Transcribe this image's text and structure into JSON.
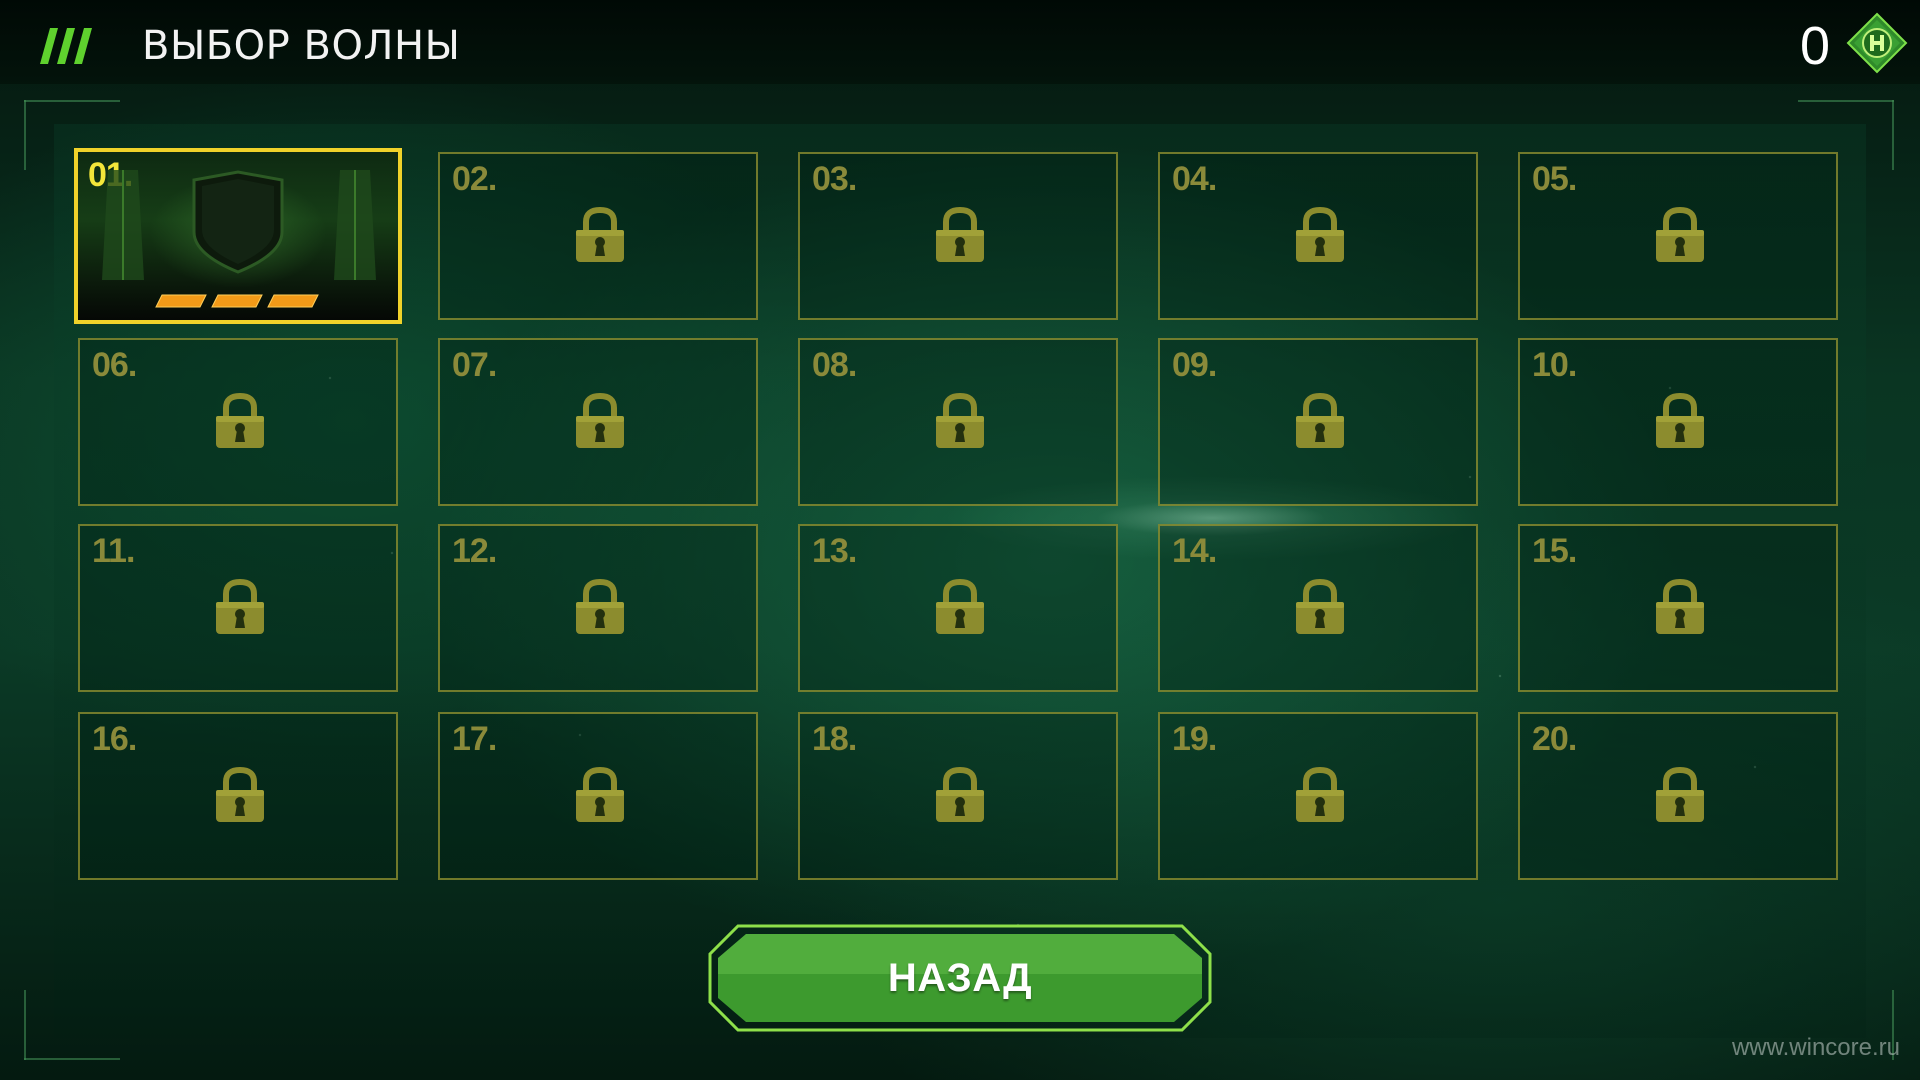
{
  "header": {
    "title": "ВЫБОР ВОЛНЫ",
    "currency_value": "0",
    "menu_icon": "menu-stripes-icon",
    "currency_icon": "hq-emblem-icon"
  },
  "waves": [
    {
      "label": "01.",
      "locked": false,
      "stars": 3
    },
    {
      "label": "02.",
      "locked": true
    },
    {
      "label": "03.",
      "locked": true
    },
    {
      "label": "04.",
      "locked": true
    },
    {
      "label": "05.",
      "locked": true
    },
    {
      "label": "06.",
      "locked": true
    },
    {
      "label": "07.",
      "locked": true
    },
    {
      "label": "08.",
      "locked": true
    },
    {
      "label": "09.",
      "locked": true
    },
    {
      "label": "10.",
      "locked": true
    },
    {
      "label": "11.",
      "locked": true
    },
    {
      "label": "12.",
      "locked": true
    },
    {
      "label": "13.",
      "locked": true
    },
    {
      "label": "14.",
      "locked": true
    },
    {
      "label": "15.",
      "locked": true
    },
    {
      "label": "16.",
      "locked": true
    },
    {
      "label": "17.",
      "locked": true
    },
    {
      "label": "18.",
      "locked": true
    },
    {
      "label": "19.",
      "locked": true
    },
    {
      "label": "20.",
      "locked": true
    }
  ],
  "footer": {
    "back_label": "НАЗАД"
  },
  "watermark": "www.wincore.ru",
  "colors": {
    "accent_yellow": "#f0d22a",
    "locked_border": "#96963a",
    "button_green": "#3d9a2e",
    "button_outline": "#8ee04a"
  }
}
